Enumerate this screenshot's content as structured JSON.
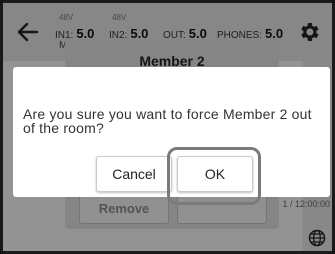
{
  "header": {
    "meters": [
      {
        "super": "48V",
        "label": "IN1:",
        "value": "5.0"
      },
      {
        "super": "48V",
        "label": "IN2:",
        "value": "5.0"
      },
      {
        "label": "OUT:",
        "value": "5.0"
      },
      {
        "label": "PHONES:",
        "value": "5.0"
      }
    ],
    "meter_sublabel": "M"
  },
  "background": {
    "panel_title": "Member 2",
    "remove_label": "Remove",
    "time_text": "1 / 12:00:00"
  },
  "dialog": {
    "message": "Are you sure you want to force Member 2 out of the room?",
    "cancel_label": "Cancel",
    "ok_label": "OK"
  },
  "colors": {
    "topbar": "#dadada",
    "overlay": "rgba(0,0,0,0.38)",
    "highlight": "#7a7a7a"
  },
  "icons": [
    "back-arrow-icon",
    "gear-icon",
    "globe-icon"
  ]
}
